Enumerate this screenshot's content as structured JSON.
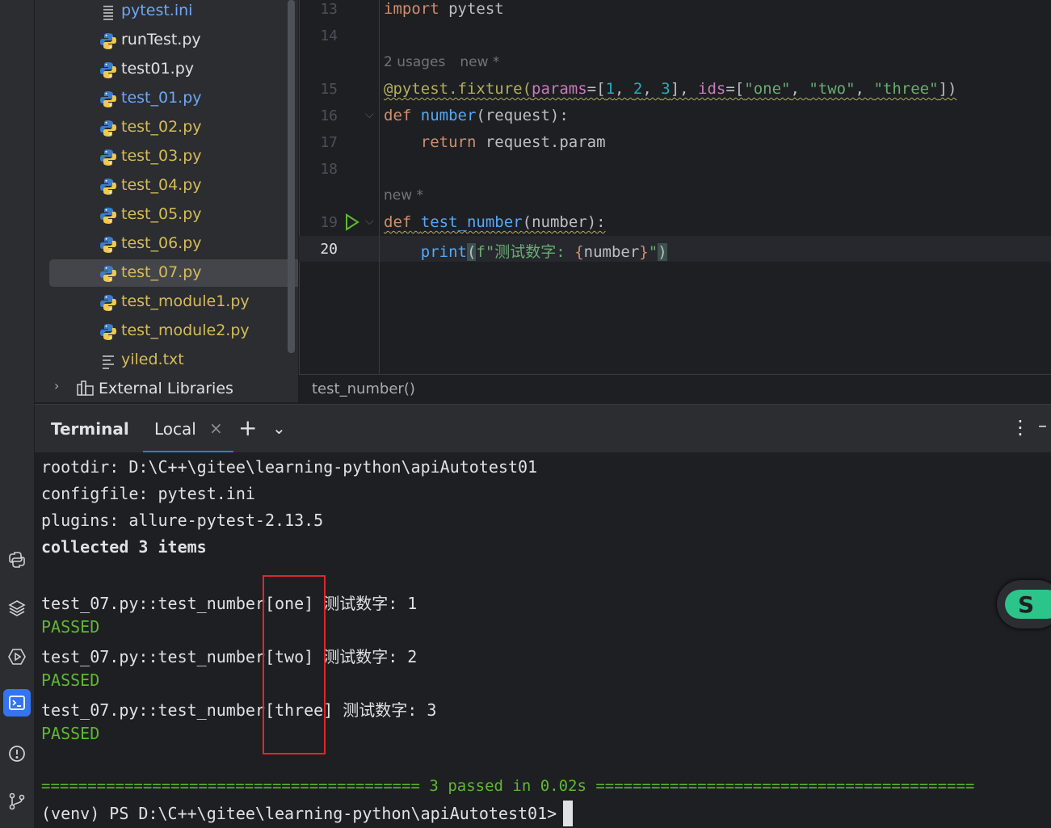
{
  "project_tree": {
    "items": [
      {
        "label": "pytest.ini",
        "icon": "ini-file-icon",
        "color": "blue"
      },
      {
        "label": "runTest.py",
        "icon": "python-file-icon",
        "color": "white"
      },
      {
        "label": "test01.py",
        "icon": "python-file-icon",
        "color": "white"
      },
      {
        "label": "test_01.py",
        "icon": "python-file-icon",
        "color": "blue"
      },
      {
        "label": "test_02.py",
        "icon": "python-file-icon",
        "color": "yellow"
      },
      {
        "label": "test_03.py",
        "icon": "python-file-icon",
        "color": "yellow"
      },
      {
        "label": "test_04.py",
        "icon": "python-file-icon",
        "color": "yellow"
      },
      {
        "label": "test_05.py",
        "icon": "python-file-icon",
        "color": "yellow"
      },
      {
        "label": "test_06.py",
        "icon": "python-file-icon",
        "color": "yellow"
      },
      {
        "label": "test_07.py",
        "icon": "python-file-icon",
        "color": "yellow",
        "selected": true
      },
      {
        "label": "test_module1.py",
        "icon": "python-file-icon",
        "color": "yellow"
      },
      {
        "label": "test_module2.py",
        "icon": "python-file-icon",
        "color": "yellow"
      },
      {
        "label": "yiled.txt",
        "icon": "text-file-icon",
        "color": "yellow"
      }
    ],
    "external_libraries": "External Libraries"
  },
  "editor": {
    "line_numbers": [
      "13",
      "14",
      "15",
      "16",
      "17",
      "18",
      "19",
      "20"
    ],
    "hint_usages": "2 usages",
    "hint_new1": "new *",
    "hint_new2": "new *",
    "code": {
      "l13_kw": "import",
      "l13_rest": " pytest",
      "l15_deco": "@pytest.fixture(",
      "l15_p1": "params",
      "l15_eq1": "=[",
      "l15_n1": "1",
      "l15_c1": ", ",
      "l15_n2": "2",
      "l15_c2": ", ",
      "l15_n3": "3",
      "l15_mid": "], ",
      "l15_p2": "ids",
      "l15_eq2": "=[",
      "l15_s1": "\"one\"",
      "l15_c3": ", ",
      "l15_s2": "\"two\"",
      "l15_c4": ", ",
      "l15_s3": "\"three\"",
      "l15_end": "])",
      "l16_kw": "def",
      "l16_fn": "number",
      "l16_rest": "(request):",
      "l17_kw": "return",
      "l17_rest": " request.param",
      "l19_kw": "def",
      "l19_fn": "test_number",
      "l19_rest": "(number):",
      "l20_fn": "print",
      "l20_p": "(",
      "l20_str": "f\"测试数字: ",
      "l20_brace": "{",
      "l20_var": "number",
      "l20_brace2": "}",
      "l20_q": "\"",
      "l20_end": ")"
    },
    "breadcrumb": "test_number()"
  },
  "terminal": {
    "title": "Terminal",
    "tab_label": "Local",
    "lines": [
      "rootdir: D:\\C++\\gitee\\learning-python\\apiAutotest01",
      "configfile: pytest.ini",
      "plugins: allure-pytest-2.13.5",
      "collected 3 items"
    ],
    "results": [
      {
        "name": "test_07.py::test_number[one] 测试数字: 1",
        "status": "PASSED"
      },
      {
        "name": "test_07.py::test_number[two] 测试数字: 2",
        "status": "PASSED"
      },
      {
        "name": "test_07.py::test_number[three] 测试数字: 3",
        "status": "PASSED"
      }
    ],
    "summary": "========================================= 3 passed in 0.02s =========================================",
    "prompt": "(venv) PS D:\\C++\\gitee\\learning-python\\apiAutotest01>"
  },
  "colors": {
    "accent": "#3574f0",
    "passed": "#5fb832",
    "highlight_box": "#e0262b"
  }
}
